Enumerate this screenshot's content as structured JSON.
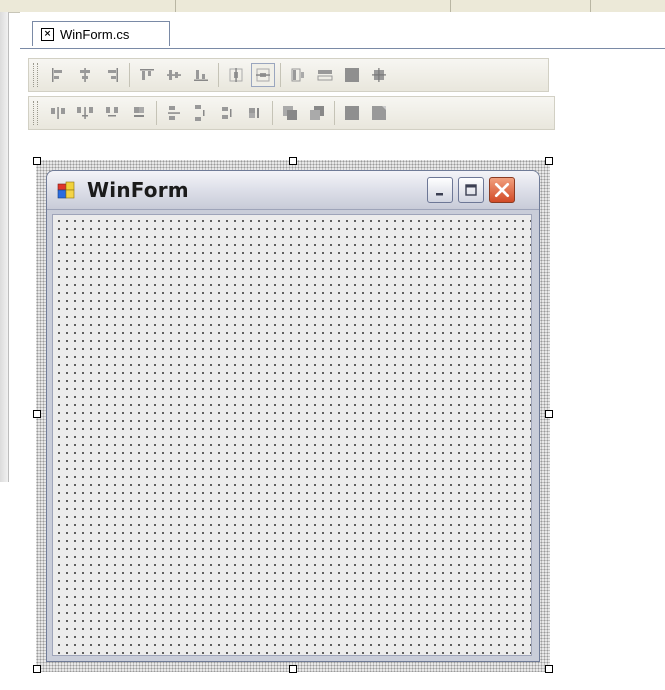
{
  "document_tab": {
    "label": "WinForm.cs",
    "close_glyph": "×"
  },
  "form": {
    "title": "WinForm"
  },
  "toolbars": {
    "layout_row1": [
      "align-lefts-icon",
      "align-centers-icon",
      "align-rights-icon",
      "align-tops-icon",
      "align-middles-icon",
      "align-bottoms-icon",
      "center-horizontally-icon",
      "center-vertically-icon",
      "make-same-width-icon",
      "make-same-height-icon",
      "make-same-size-icon",
      "size-to-grid-icon"
    ],
    "layout_row2": [
      "make-horizontal-spacing-equal-icon",
      "increase-horizontal-spacing-icon",
      "decrease-horizontal-spacing-icon",
      "remove-horizontal-spacing-icon",
      "make-vertical-spacing-equal-icon",
      "increase-vertical-spacing-icon",
      "decrease-vertical-spacing-icon",
      "remove-vertical-spacing-icon",
      "bring-to-front-icon",
      "send-to-back-icon",
      "lock-controls-icon",
      "tab-order-icon"
    ]
  },
  "colors": {
    "caption_close": "#d24a27",
    "selection_frame": "#e8e8e8",
    "client_area": "#ececec"
  }
}
